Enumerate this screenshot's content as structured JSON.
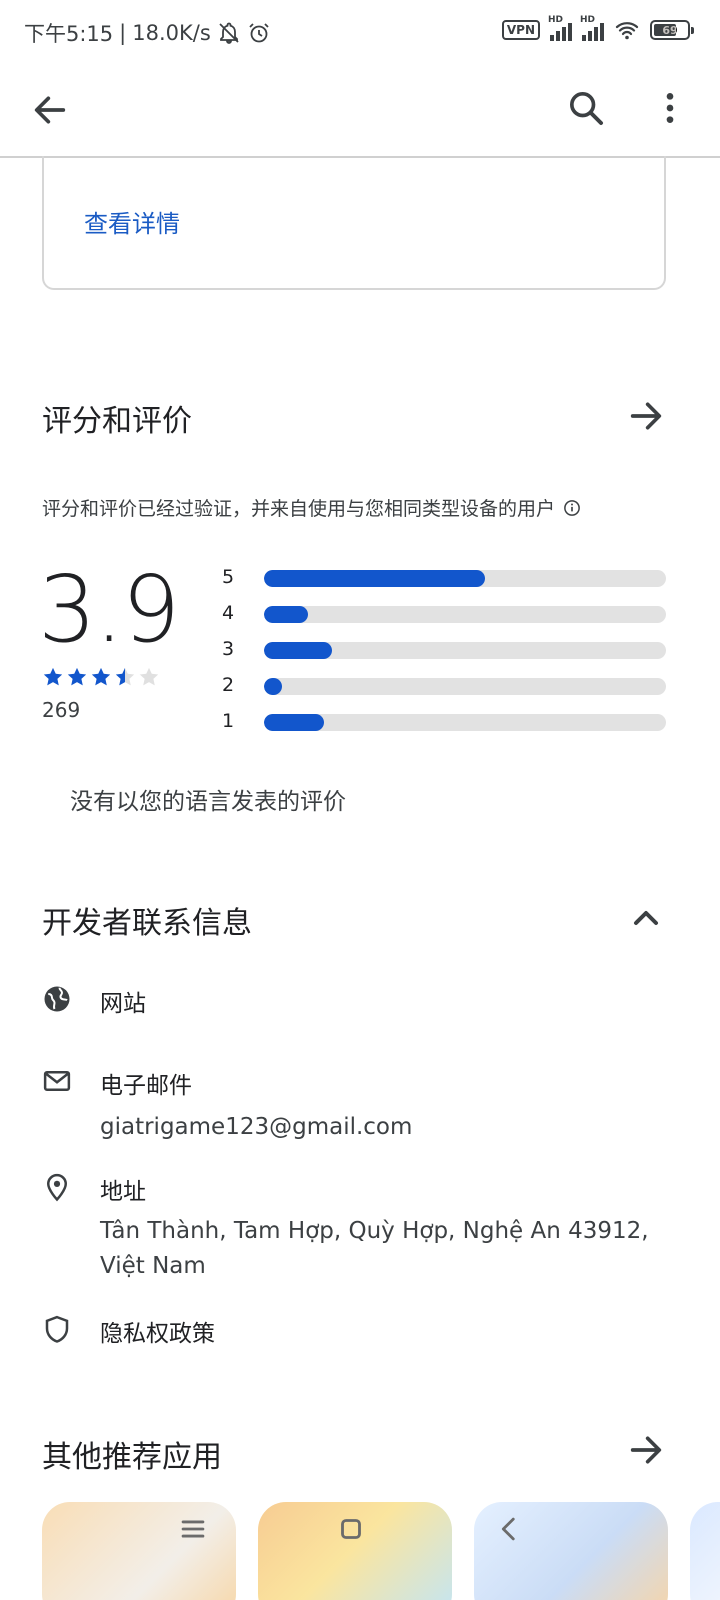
{
  "status_bar": {
    "time": "下午5:15",
    "speed": "18.0K/s",
    "vpn": "VPN",
    "hd": "HD",
    "battery": "69",
    "battery_level": 0.69
  },
  "app_bar": {
    "back_icon": "arrow-back-icon",
    "search_icon": "search-icon",
    "more_icon": "more-vert-icon"
  },
  "details": {
    "link": "查看详情"
  },
  "ratings": {
    "title": "评分和评价",
    "note": "评分和评价已经过验证，并来自使用与您相同类型设备的用户",
    "score": "3.9",
    "stars": 3.5,
    "count": "269",
    "bars": [
      {
        "label": "5",
        "fraction": 0.55
      },
      {
        "label": "4",
        "fraction": 0.11
      },
      {
        "label": "3",
        "fraction": 0.17
      },
      {
        "label": "2",
        "fraction": 0.045
      },
      {
        "label": "1",
        "fraction": 0.15
      }
    ],
    "no_reviews": "没有以您的语言发表的评价"
  },
  "developer": {
    "title": "开发者联系信息",
    "website": "网站",
    "email_label": "电子邮件",
    "email": "giatrigame123@gmail.com",
    "address_label": "地址",
    "address": "Tân Thành, Tam Hợp, Quỳ Hợp, Nghệ An 43912, Việt Nam",
    "privacy": "隐私权政策"
  },
  "recommended": {
    "title": "其他推荐应用"
  },
  "colors": {
    "accent": "#1256cc",
    "link": "#1a5bc4"
  }
}
